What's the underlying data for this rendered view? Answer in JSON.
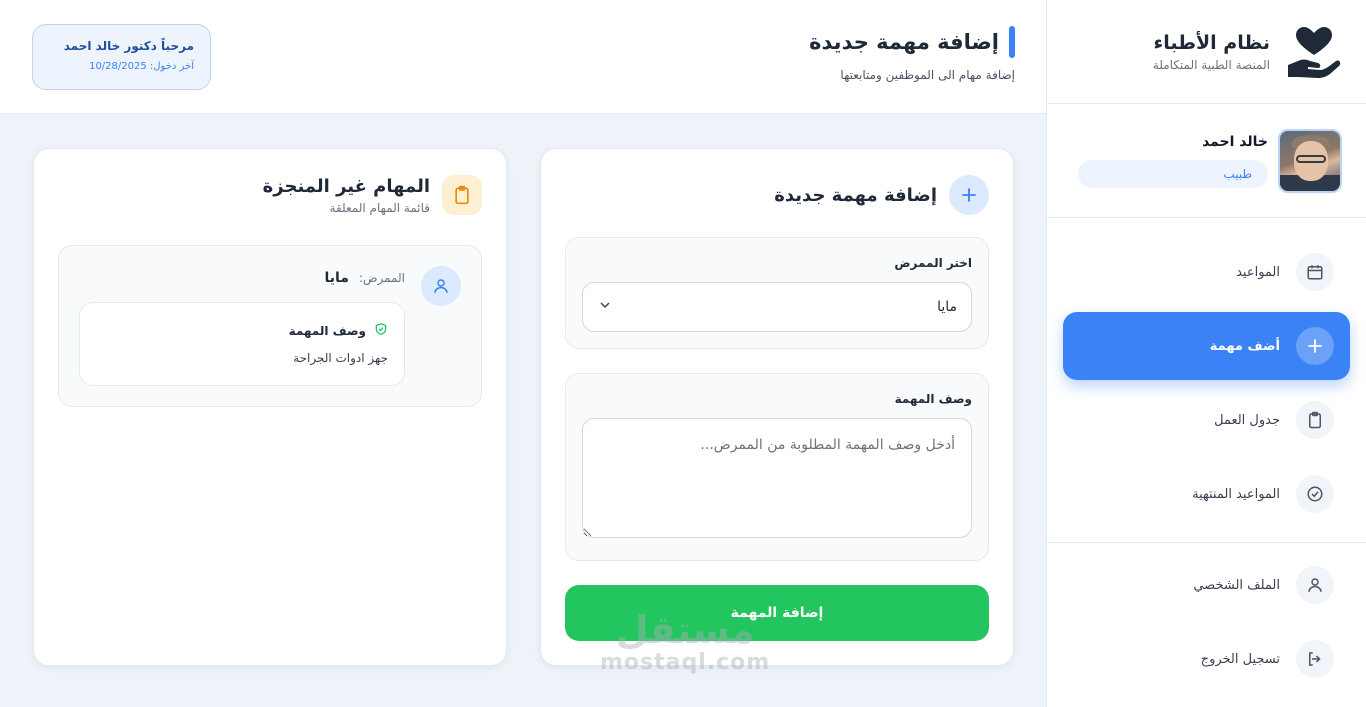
{
  "brand": {
    "title": "نظام الأطباء",
    "subtitle": "المنصة الطبية المتكاملة",
    "icon": "heart-hand-icon"
  },
  "profile": {
    "name": "خالد احمد",
    "role": "طبيب"
  },
  "nav": {
    "items": [
      {
        "label": "المواعيد",
        "icon": "calendar-icon"
      },
      {
        "label": "أضف مهمة",
        "icon": "plus-icon",
        "active": true
      },
      {
        "label": "جدول العمل",
        "icon": "clipboard-icon"
      },
      {
        "label": "المواعيد المنتهية",
        "icon": "check-circle-icon"
      }
    ],
    "account": [
      {
        "label": "الملف الشخصي",
        "icon": "user-icon"
      },
      {
        "label": "تسجيل الخروج",
        "icon": "logout-icon"
      }
    ]
  },
  "header": {
    "title": "إضافة مهمة جديدة",
    "subtitle": "إضافة مهام الى الموظفين ومتابعتها",
    "welcome": "مرحباً دكتور خالد احمد",
    "last_login": "آخر دخول: 10/28/2025"
  },
  "form": {
    "title": "إضافة مهمة جديدة",
    "nurse_label": "اختر الممرض",
    "nurse_selected": "مايا",
    "desc_label": "وصف المهمة",
    "desc_placeholder": "أدخل وصف المهمة المطلوبة من الممرض...",
    "submit_label": "إضافة المهمة"
  },
  "pending": {
    "title": "المهام غير المنجزة",
    "subtitle": "قائمة المهام المعلقة",
    "tasks": [
      {
        "nurse_label": "الممرض:",
        "nurse_name": "مايا",
        "desc_title": "وصف المهمة",
        "desc": "جهز ادوات الجراحة"
      }
    ]
  },
  "watermark": {
    "ar": "مستقل",
    "en": "mostaql.com"
  },
  "colors": {
    "primary": "#3b82f6",
    "success": "#22c55e",
    "warning": "#f59e0b",
    "background": "#eef3fa"
  }
}
